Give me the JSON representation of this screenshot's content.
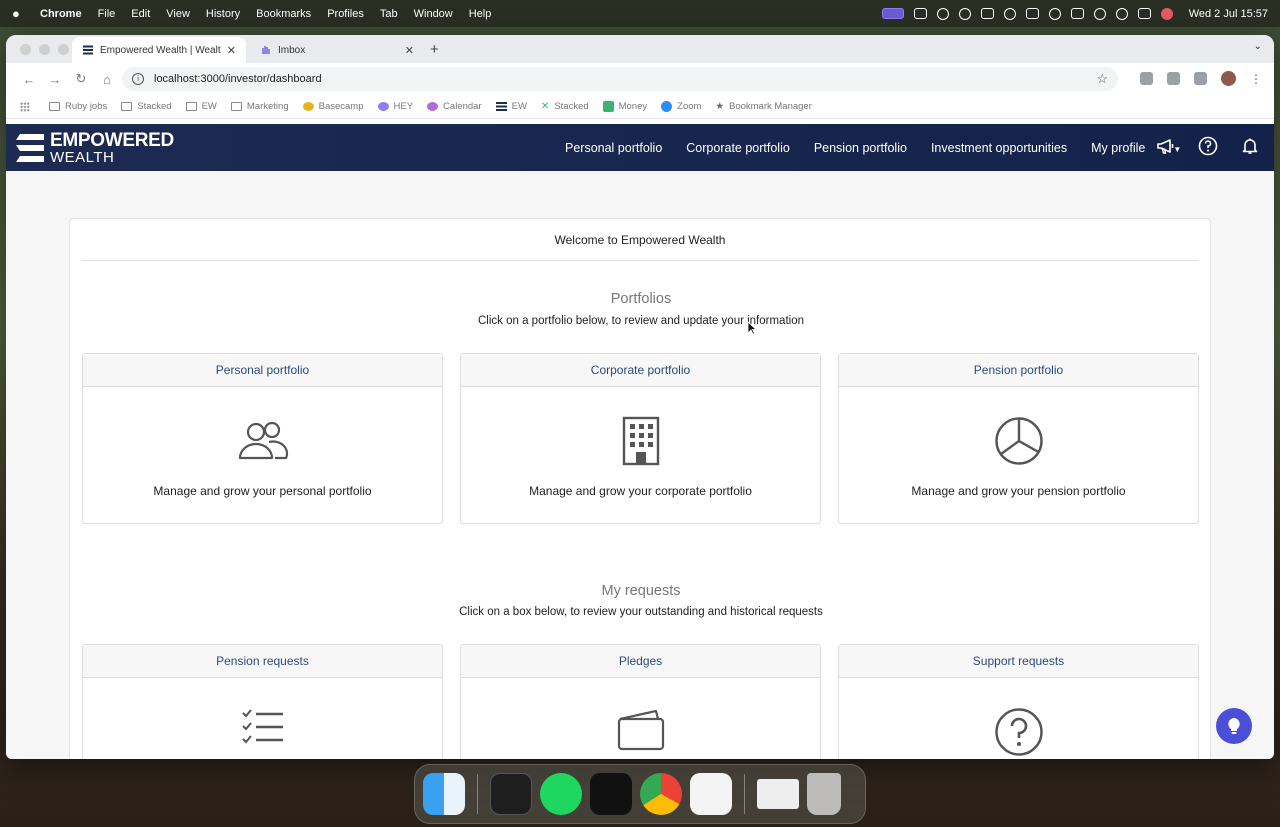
{
  "menubar": {
    "app": "Chrome",
    "items": [
      "File",
      "Edit",
      "View",
      "History",
      "Bookmarks",
      "Profiles",
      "Tab",
      "Window",
      "Help"
    ],
    "clock": "Wed 2 Jul  15:57"
  },
  "browser": {
    "tabs": [
      {
        "title": "Empowered Wealth | Wealth M",
        "active": true
      },
      {
        "title": "Imbox",
        "active": false
      }
    ],
    "url": "localhost:3000/investor/dashboard",
    "bookmarks": [
      "Ruby jobs",
      "Stacked",
      "EW",
      "Marketing",
      "Basecamp",
      "HEY",
      "Calendar",
      "EW",
      "Stacked",
      "Money",
      "Zoom",
      "Bookmark Manager"
    ]
  },
  "appnav": {
    "brand_line1": "EMPOWERED",
    "brand_line2": "WEALTH",
    "links": [
      "Personal portfolio",
      "Corporate portfolio",
      "Pension portfolio",
      "Investment opportunities"
    ],
    "profile": "My profile"
  },
  "dashboard": {
    "welcome": "Welcome to Empowered Wealth",
    "portfolios": {
      "title": "Portfolios",
      "subtitle": "Click on a portfolio below, to review and update your information",
      "tiles": [
        {
          "title": "Personal portfolio",
          "icon": "people-icon",
          "description": "Manage and grow your personal portfolio"
        },
        {
          "title": "Corporate portfolio",
          "icon": "building-icon",
          "description": "Manage and grow your corporate portfolio"
        },
        {
          "title": "Pension portfolio",
          "icon": "pie-chart-icon",
          "description": "Manage and grow your pension portfolio"
        }
      ]
    },
    "requests": {
      "title": "My requests",
      "subtitle": "Click on a box below, to review your outstanding and historical requests",
      "tiles": [
        {
          "title": "Pension requests",
          "icon": "checklist-icon"
        },
        {
          "title": "Pledges",
          "icon": "wallet-icon"
        },
        {
          "title": "Support requests",
          "icon": "question-icon"
        }
      ]
    }
  },
  "colors": {
    "nav": "#1d2b52",
    "tile_title": "#2c4a7c",
    "chat_button": "#4b4fd8"
  }
}
